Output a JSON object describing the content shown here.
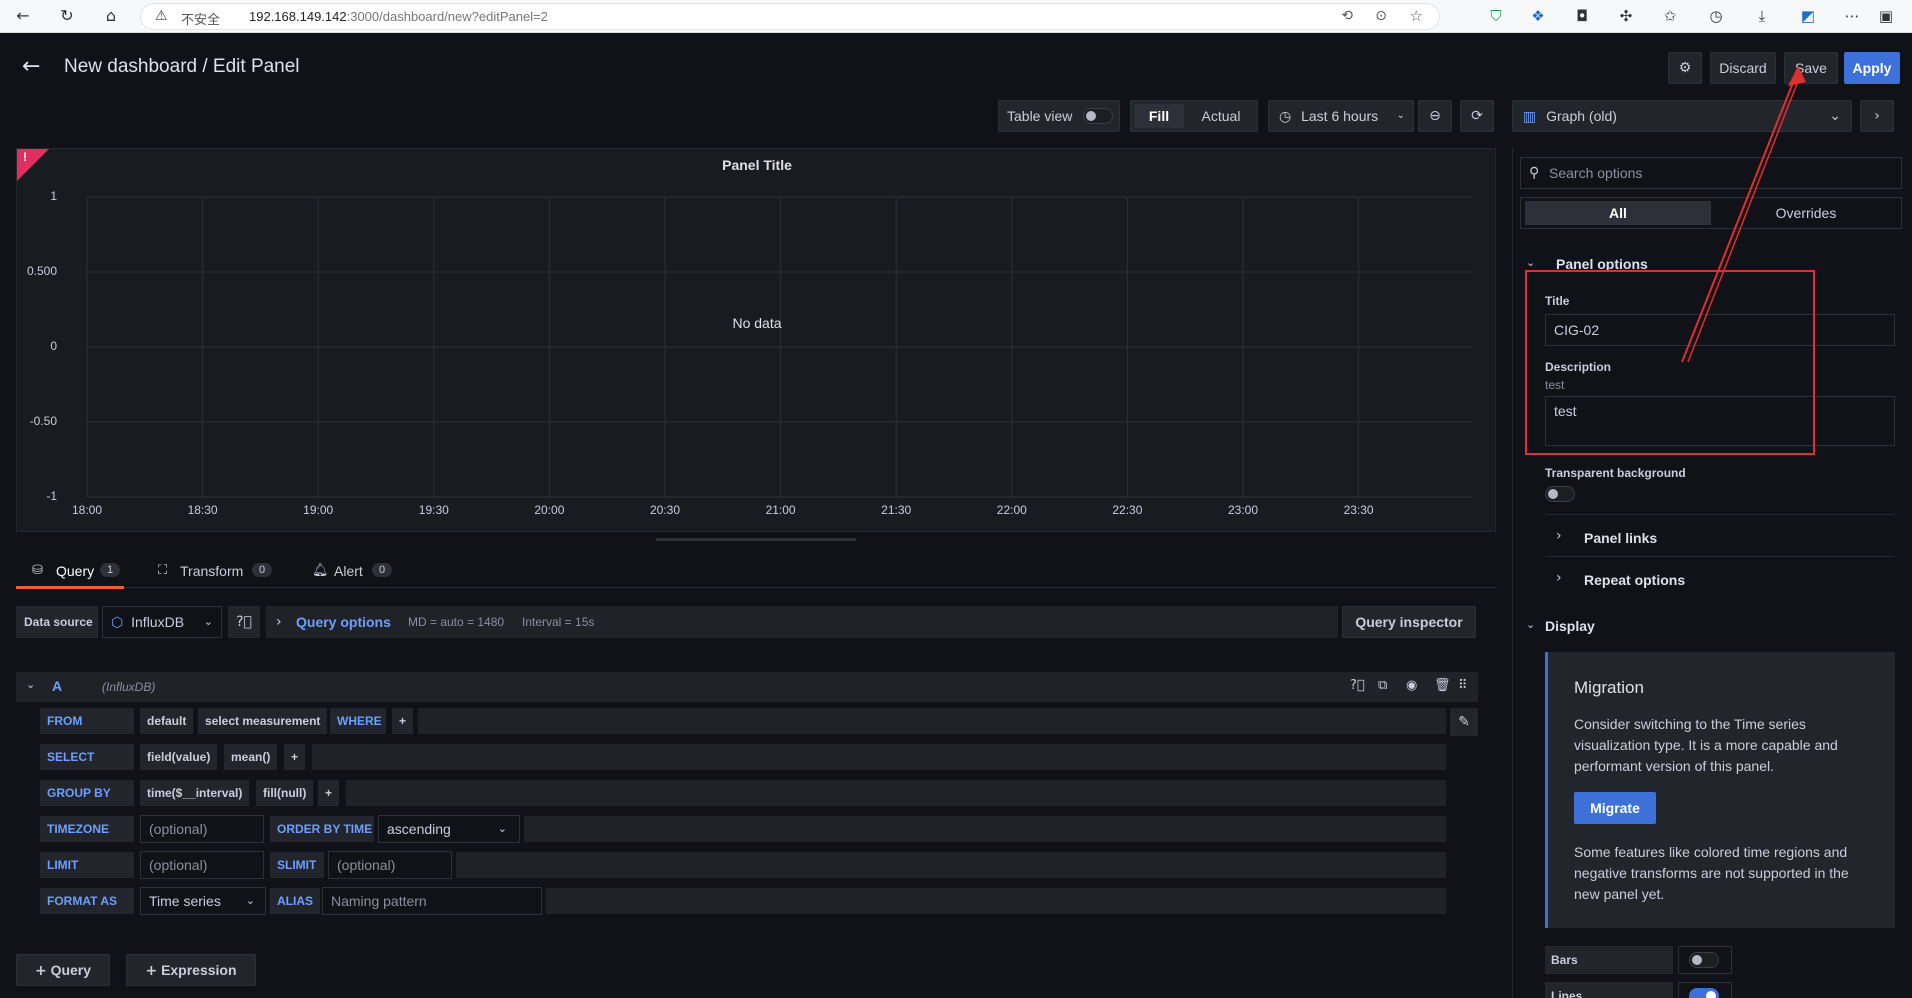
{
  "browser": {
    "security_label": "不安全",
    "url_host": "192.168.149.142",
    "url_rest": ":3000/dashboard/new?editPanel=2"
  },
  "header": {
    "title": "New dashboard / Edit Panel",
    "discard_label": "Discard",
    "save_label": "Save",
    "apply_label": "Apply"
  },
  "toolbar": {
    "table_view_label": "Table view",
    "fill_label": "Fill",
    "actual_label": "Actual",
    "time_range_label": "Last 6 hours",
    "visualization_label": "Graph (old)"
  },
  "panel": {
    "title": "Panel Title",
    "no_data": "No data",
    "y_ticks": [
      "1",
      "0.500",
      "0",
      "-0.50",
      "-1"
    ],
    "x_ticks": [
      "18:00",
      "18:30",
      "19:00",
      "19:30",
      "20:00",
      "20:30",
      "21:00",
      "21:30",
      "22:00",
      "22:30",
      "23:00",
      "23:30"
    ]
  },
  "tabs": [
    {
      "label": "Query",
      "count": "1"
    },
    {
      "label": "Transform",
      "count": "0"
    },
    {
      "label": "Alert",
      "count": "0"
    }
  ],
  "datasource": {
    "label": "Data source",
    "value": "InfluxDB",
    "query_options": "Query options",
    "md": "MD = auto = 1480",
    "interval": "Interval = 15s",
    "inspector": "Query inspector"
  },
  "query": {
    "ref": "A",
    "ds": "(InfluxDB)",
    "from_kw": "FROM",
    "from_default": "default",
    "from_measurement": "select measurement",
    "where_kw": "WHERE",
    "plus": "+",
    "select_kw": "SELECT",
    "select_field": "field(value)",
    "select_fn": "mean()",
    "groupby_kw": "GROUP BY",
    "groupby_time": "time($__interval)",
    "groupby_fill": "fill(null)",
    "timezone_kw": "TIMEZONE",
    "optional": "(optional)",
    "orderby_kw": "ORDER BY TIME",
    "orderby_value": "ascending",
    "limit_kw": "LIMIT",
    "slimit_kw": "SLIMIT",
    "format_kw": "FORMAT AS",
    "format_value": "Time series",
    "alias_kw": "ALIAS",
    "alias_placeholder": "Naming pattern"
  },
  "bottom_buttons": {
    "query": "Query",
    "expression": "Expression"
  },
  "options": {
    "search_placeholder": "Search options",
    "tab_all": "All",
    "tab_overrides": "Overrides",
    "panel_options": "Panel options",
    "title_label": "Title",
    "title_value": "CIG-02",
    "description_label": "Description",
    "description_sub": "test",
    "description_value": "test",
    "transparent_label": "Transparent background",
    "panel_links": "Panel links",
    "repeat_options": "Repeat options",
    "display": "Display",
    "migration_title": "Migration",
    "migration_text": "Consider switching to the Time series visualization type. It is a more capable and performant version of this panel.",
    "migrate_button": "Migrate",
    "migration_note": "Some features like colored time regions and negative transforms are not supported in the new panel yet.",
    "bars_label": "Bars",
    "lines_label": "Lines"
  },
  "annotation": {
    "color": "#e02f2f"
  }
}
